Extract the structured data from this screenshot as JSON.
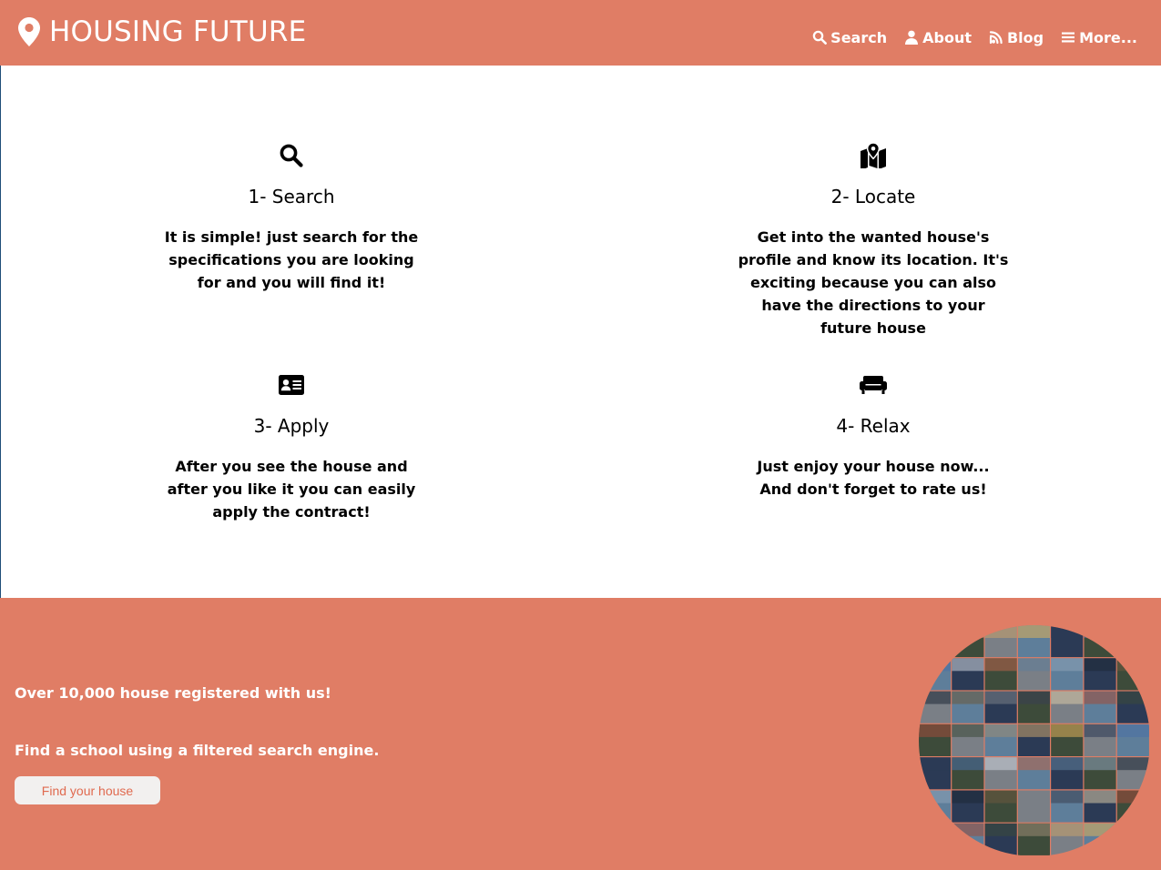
{
  "brand": {
    "name": "HOUSING FUTURE",
    "icon": "map-marker-icon"
  },
  "nav": {
    "search": "Search",
    "about": "About",
    "blog": "Blog",
    "more": "More..."
  },
  "steps": [
    {
      "icon": "search-icon",
      "title": "1- Search",
      "text": "It is simple! just search for the specifications you are looking for and you will find it!"
    },
    {
      "icon": "map-icon",
      "title": "2- Locate",
      "text": "Get into the wanted house's profile and know its location. It's exciting because you can also have the directions to your future house"
    },
    {
      "icon": "id-card-icon",
      "title": "3- Apply",
      "text": "After you see the house and after you like it you can easily apply the contract!"
    },
    {
      "icon": "couch-icon",
      "title": "4- Relax",
      "text_line1": "Just enjoy your house now...",
      "text_line2": "And don't forget to rate us!"
    }
  ],
  "footer": {
    "registered": "Over 10,000 house registered with us!",
    "school": "Find a school using a filtered search engine.",
    "button": "Find your house"
  },
  "colors": {
    "accent": "#e07d65",
    "button_text": "#e06a4f",
    "button_bg": "#f2f0ef"
  }
}
